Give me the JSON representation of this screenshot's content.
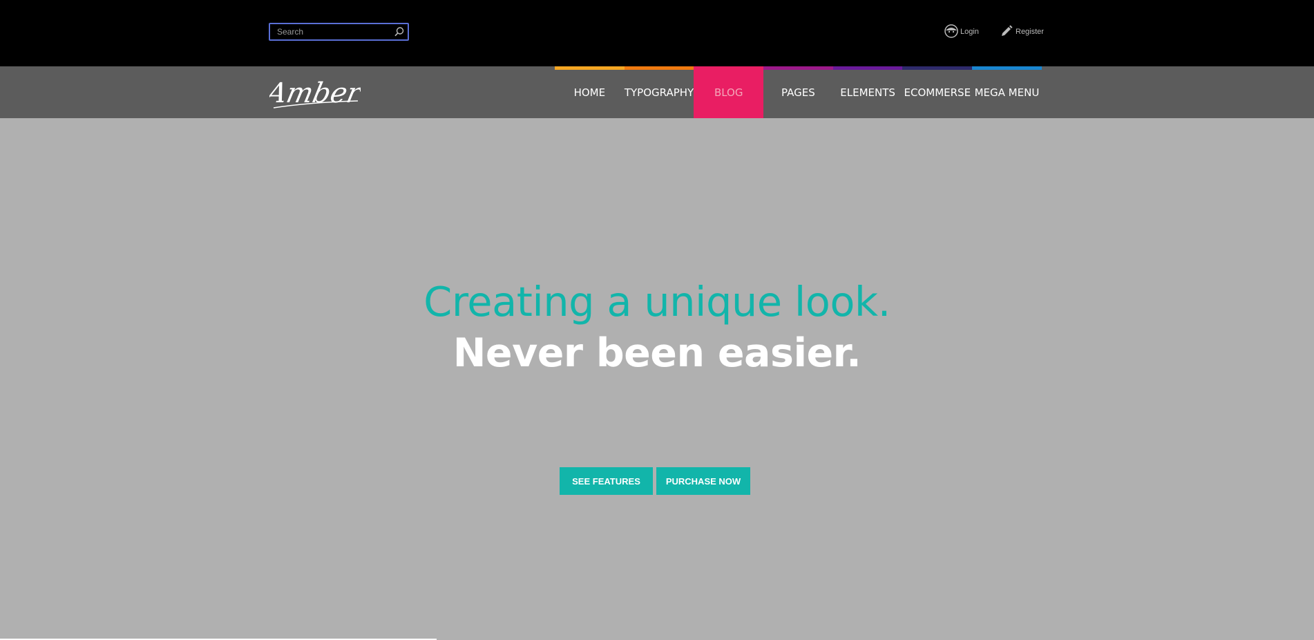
{
  "header": {
    "search": {
      "placeholder": "Search",
      "icon": "search-icon"
    },
    "login_label": "Login",
    "register_label": "Register"
  },
  "brand": {
    "logo_text": "Amber"
  },
  "nav": {
    "items": [
      {
        "label": "HOME",
        "color": "#f5a623"
      },
      {
        "label": "TYPOGRAPHY",
        "color": "#f07a10"
      },
      {
        "label": "BLOG",
        "color": "#e91e63",
        "active": true
      },
      {
        "label": "PAGES",
        "color": "#9c1a8a"
      },
      {
        "label": "ELEMENTS",
        "color": "#6a1b9a"
      },
      {
        "label": "ECOMMERSE",
        "color": "#2e2a6b"
      },
      {
        "label": "MEGA MENU",
        "color": "#1a86d0"
      }
    ]
  },
  "hero": {
    "line1": "Creating a unique look.",
    "line2": "Never been easier.",
    "buttons": {
      "features": "SEE FEATURES",
      "purchase": "PURCHASE NOW"
    }
  },
  "colors": {
    "accent": "#12b5aa",
    "active_menu_bg": "#e91e63"
  }
}
